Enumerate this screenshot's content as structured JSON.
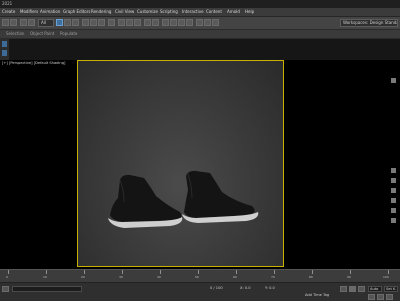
{
  "window": {
    "title": "2021"
  },
  "menu": {
    "items": [
      "Create",
      "Modifiers",
      "Animation",
      "Graph Editors",
      "Rendering",
      "Civil View",
      "Customize",
      "Scripting",
      "Interactive",
      "Content",
      "Arnold",
      "Help"
    ]
  },
  "toolbar": {
    "selection_filter": "All",
    "workspace": "Workspaces: Design Standard"
  },
  "ribbon": {
    "labels": [
      "Selection",
      "Object Paint",
      "Populate"
    ]
  },
  "viewport": {
    "label": "[+] [Perspective] [Default Shading]",
    "bg_top": "#2a2a2a",
    "bg_center": "#4b4b4b",
    "frame_color": "#c9b000"
  },
  "timeline": {
    "ticks": [
      "0",
      "10",
      "20",
      "30",
      "40",
      "50",
      "60",
      "70",
      "80",
      "90",
      "100"
    ]
  },
  "status": {
    "frame_field": "0 / 100",
    "x_field": "X: 0.0",
    "y_field": "Y: 0.0",
    "add_time_tag": "Add Time Tag",
    "auto_key": "Auto",
    "set_key": "Set K."
  },
  "icons": {
    "play": "play-icon",
    "prev": "prev-frame-icon",
    "next": "next-frame-icon"
  }
}
